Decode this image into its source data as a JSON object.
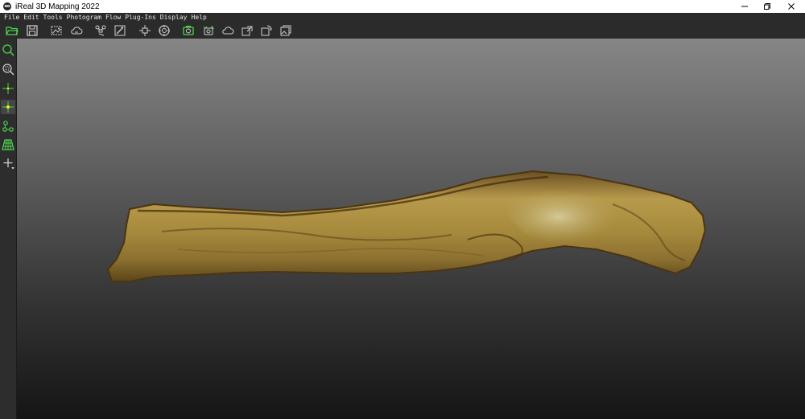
{
  "window": {
    "title": "iReal 3D Mapping 2022"
  },
  "menu": [
    "File",
    "Edit",
    "Tools",
    "Photogram",
    "Flow",
    "Plug-Ins",
    "Display",
    "Help"
  ],
  "toolbar": {
    "icons": [
      "folder-open-icon",
      "save-icon",
      "image-select-icon",
      "cloud-icon",
      "drone-icon",
      "edit-icon",
      "align-icon",
      "target-icon",
      "green-camera-icon",
      "camera-sync-icon",
      "cloud-outline-icon",
      "model-export-icon",
      "model-sync-icon",
      "model-texture-icon"
    ]
  },
  "sidebar": {
    "icons": [
      "zoom-icon",
      "zoom-fit-icon",
      "crosshair-icon",
      "crosshair-point-icon",
      "network-icon",
      "grid-icon",
      "add-menu-icon"
    ]
  },
  "colors": {
    "accent": "#4cd64c",
    "toolbar_bg": "#2b2b2b",
    "icon": "#cfcfcf"
  }
}
